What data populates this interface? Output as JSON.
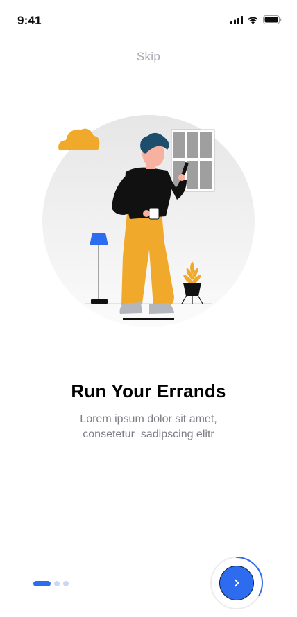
{
  "status_bar": {
    "time": "9:41",
    "icons": [
      "cellular-signal-icon",
      "wifi-icon",
      "battery-icon"
    ]
  },
  "onboarding": {
    "skip_label": "Skip",
    "title": "Run Your Errands",
    "subtitle_lines": [
      "Lorem ipsum dolor sit amet,",
      "consetetur  sadipscing elitr"
    ],
    "page_count": 3,
    "current_page": 1,
    "next_progress": 0.33,
    "next_icon": "chevron-right-icon"
  },
  "colors": {
    "accent": "#2d6bef",
    "pager_inactive": "#c9d6f5",
    "illustration_yellow": "#f0a92a",
    "illustration_dark": "#111111",
    "skip_text": "#a8a8b3",
    "subtitle_text": "#7d7d86"
  }
}
